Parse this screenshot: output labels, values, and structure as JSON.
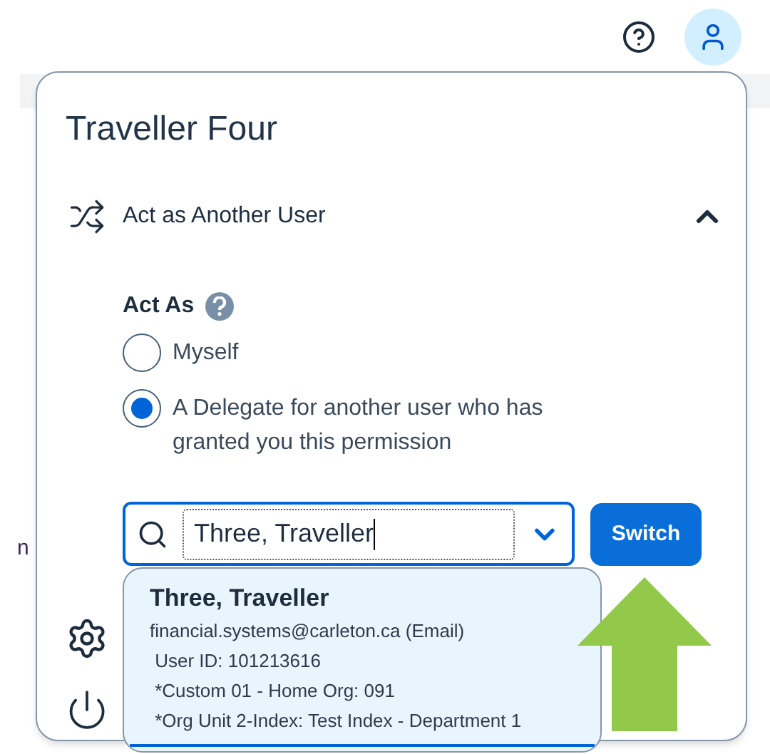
{
  "background_fragment": "n",
  "panel": {
    "user_name": "Traveller Four",
    "section": {
      "title": "Act as Another User",
      "expanded": true
    },
    "act_as": {
      "label": "Act As",
      "options": [
        {
          "label": "Myself",
          "selected": false
        },
        {
          "label": "A Delegate for another user who has granted you this permission",
          "selected": true
        }
      ]
    },
    "search": {
      "value": "Three, Traveller"
    },
    "switch_button": "Switch",
    "suggestion": {
      "name": "Three, Traveller",
      "lines": [
        "financial.systems@carleton.ca (Email)",
        " User ID: 101213616",
        " *Custom 01 - Home Org: 091",
        " *Org Unit 2-Index: Test Index - Department 1"
      ]
    }
  }
}
